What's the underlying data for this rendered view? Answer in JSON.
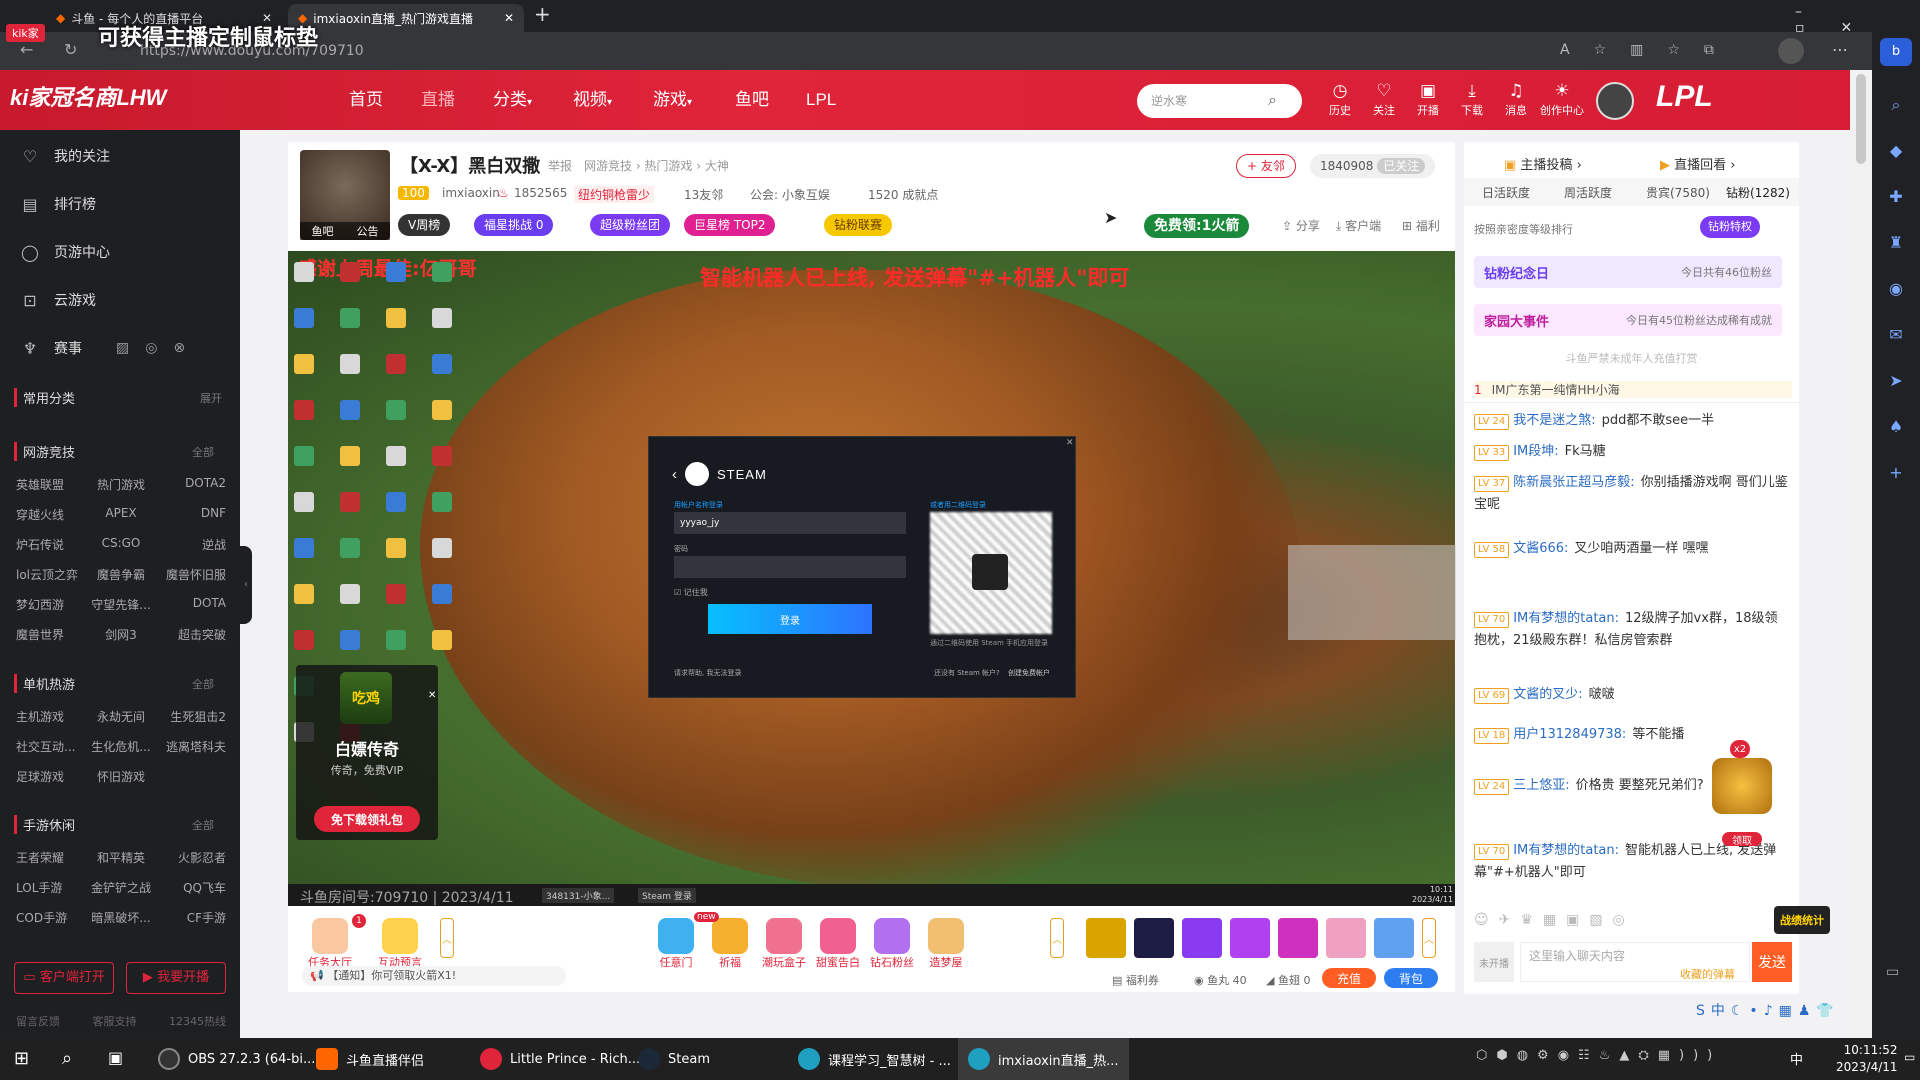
{
  "browser": {
    "tabs": [
      {
        "label": "斗鱼 - 每个人的直播平台"
      },
      {
        "label": "imxiaoxin直播_热门游戏直播"
      }
    ],
    "url": "https://www.douyu.com/709710",
    "overlay_text": "可获得主播定制鼠标垫",
    "overlay_badge": "kik家"
  },
  "header": {
    "logo_text": "ki家冠名商LHW",
    "nav": [
      "首页",
      "直播",
      "分类",
      "视频",
      "游戏",
      "鱼吧",
      "LPL"
    ],
    "search_placeholder": "逆水寒",
    "icons": [
      {
        "label": "历史",
        "icon": "clock-icon"
      },
      {
        "label": "关注",
        "icon": "heart-icon"
      },
      {
        "label": "开播",
        "icon": "video-icon"
      },
      {
        "label": "下载",
        "icon": "download-icon"
      },
      {
        "label": "消息",
        "icon": "bell-icon"
      },
      {
        "label": "创作中心",
        "icon": "bulb-icon"
      }
    ],
    "banner_text": "LPL"
  },
  "sidebar": {
    "items": [
      {
        "label": "我的关注",
        "icon": "heart-icon"
      },
      {
        "label": "排行榜",
        "icon": "ranking-icon"
      },
      {
        "label": "页游中心",
        "icon": "game-icon"
      },
      {
        "label": "云游戏",
        "icon": "cloud-icon"
      },
      {
        "label": "赛事",
        "icon": "trophy-icon"
      }
    ],
    "common": {
      "title": "常用分类",
      "more": "展开"
    },
    "groups": [
      {
        "title": "网游竞技",
        "more": "全部",
        "items": [
          "英雄联盟",
          "热门游戏",
          "DOTA2",
          "穿越火线",
          "APEX",
          "DNF",
          "炉石传说",
          "CS:GO",
          "逆战",
          "lol云顶之弈",
          "魔兽争霸",
          "魔兽怀旧服",
          "梦幻西游",
          "守望先锋...",
          "DOTA",
          "魔兽世界",
          "剑网3",
          "超击突破"
        ]
      },
      {
        "title": "单机热游",
        "more": "全部",
        "items": [
          "主机游戏",
          "永劫无间",
          "生死狙击2",
          "社交互动...",
          "生化危机...",
          "逃离塔科夫",
          "足球游戏",
          "怀旧游戏"
        ]
      },
      {
        "title": "手游休闲",
        "more": "全部",
        "items": [
          "王者荣耀",
          "和平精英",
          "火影忍者",
          "LOL手游",
          "金铲铲之战",
          "QQ飞车",
          "COD手游",
          "暗黑破坏...",
          "CF手游"
        ]
      }
    ],
    "buttons": [
      "客户端打开",
      "我要开播"
    ],
    "footer": [
      "留言反馈",
      "客服支持",
      "12345热线"
    ]
  },
  "room": {
    "title": "【X-X】黑白双撒",
    "report": "举报",
    "crumbs": "网游竞技 › 热门游戏 › 大神",
    "level": "100",
    "streamer": "imxiaoxin",
    "hot": "1852565",
    "tag": "纽约铜枪雷少",
    "fans_club": "13友邻",
    "notice": "公会: 小象互娱",
    "achievements": "1520 成就点",
    "follow_btn": "+ 友邻",
    "follow_count": "1840908",
    "followed": "已关注",
    "avatar_labels": [
      "鱼吧",
      "公告"
    ],
    "badges": [
      "V周榜",
      "福星挑战 0",
      "超级粉丝团",
      "巨星榜 TOP2",
      "钻粉联赛"
    ],
    "free_gift": "免费领:1火箭",
    "actions": [
      "分享",
      "客户端",
      "福利"
    ]
  },
  "video": {
    "banner_left": "感谢上周最佳:亿哥哥",
    "banner_main": "智能机器人已上线, 发送弹幕\"#+机器人\"即可",
    "steam": {
      "title": "STEAM",
      "account_label": "用帐户名称登录",
      "account_value": "yyyao_jy",
      "password_label": "密码",
      "remember": "记住我",
      "login_btn": "登录",
      "qr_label": "或者用二维码登录",
      "qr_hint": "通过二维码使用 Steam 手机应用登录",
      "help": "请求帮助, 我无法登录",
      "no_account": "还没有 Steam 帐户?",
      "create": "创建免费帐户"
    },
    "watermark": "斗鱼房间号:709710 | 2023/4/11",
    "inner_time": "10:11",
    "inner_date": "2023/4/11",
    "inner_apps": [
      "348131-小象...",
      "Steam 登录"
    ]
  },
  "ad": {
    "title": "白嫖传奇",
    "sub": "传奇，免费VIP",
    "btn": "免下载领礼包",
    "badge": "吃鸡"
  },
  "giftbar": {
    "left": [
      {
        "label": "任务大厅",
        "badge": "1"
      },
      {
        "label": "互动预言"
      }
    ],
    "gifts": [
      "任意门",
      "祈福",
      "潮玩盒子",
      "甜蜜告白",
      "钻石粉丝",
      "造梦屋"
    ],
    "new_badge": "new",
    "notice": "【通知】你可领取火箭X1!",
    "bottom": [
      "福利券",
      "鱼丸 40",
      "鱼翅 0"
    ],
    "charge": "充值",
    "backpack": "背包"
  },
  "rightpanel": {
    "top": [
      "主播投稿",
      "直播回看"
    ],
    "tabs": [
      "日活跃度",
      "周活跃度",
      "贵宾(7580)",
      "钻粉(1282)"
    ],
    "sort_note": "按照亲密度等级排行",
    "vip_btn": "钻粉特权",
    "events": [
      {
        "title": "钻粉纪念日",
        "desc": "今日共有46位粉丝"
      },
      {
        "title": "家园大事件",
        "desc": "今日有45位粉丝达成稀有成就"
      }
    ],
    "notice": "斗鱼严禁未成年人充值打赏",
    "rank1": "IM广东第一纯情HH小海",
    "chats": [
      {
        "lv": "LV 24",
        "user": "我不是迷之煞:",
        "msg": "pdd都不敢see一半"
      },
      {
        "lv": "LV 33",
        "user": "IM段坤:",
        "msg": "Fk马糖"
      },
      {
        "lv": "LV 37",
        "user": "陈新晨张正超马彦毅:",
        "msg": "你别插播游戏啊 哥们儿鉴宝呢"
      },
      {
        "lv": "LV 58",
        "user": "文酱666:",
        "msg": "叉少咱两酒量一样 嘿嘿"
      },
      {
        "lv": "LV 70",
        "user": "IM有梦想的tatan:",
        "msg": "12级牌子加vx群，18级领抱枕，21级殿东群！私信房管索群"
      },
      {
        "lv": "LV 69",
        "user": "文酱的叉少:",
        "msg": "啵啵"
      },
      {
        "lv": "LV 18",
        "user": "用户1312849738:",
        "msg": "等不能播"
      },
      {
        "lv": "LV 24",
        "user": "三上悠亚:",
        "msg": "价格贵 要整死兄弟们?"
      },
      {
        "lv": "LV 70",
        "user": "IM有梦想的tatan:",
        "msg": "智能机器人已上线, 发送弹幕\"#+机器人\"即可"
      }
    ],
    "chest": {
      "count": "x2",
      "label": "领取"
    },
    "war_badge": "战绩统计",
    "input_placeholder": "这里输入聊天内容",
    "input_hint": "收藏的弹幕",
    "send": "发送",
    "login_hint": "未开播"
  },
  "ostaskbar": {
    "apps": [
      "OBS 27.2.3 (64-bi...",
      "斗鱼直播伴侣",
      "Little Prince - Rich...",
      "Steam",
      "课程学习_智慧树 - ...",
      "imxiaoxin直播_热..."
    ],
    "time": "10:11:52",
    "date": "2023/4/11",
    "lang": "中"
  }
}
